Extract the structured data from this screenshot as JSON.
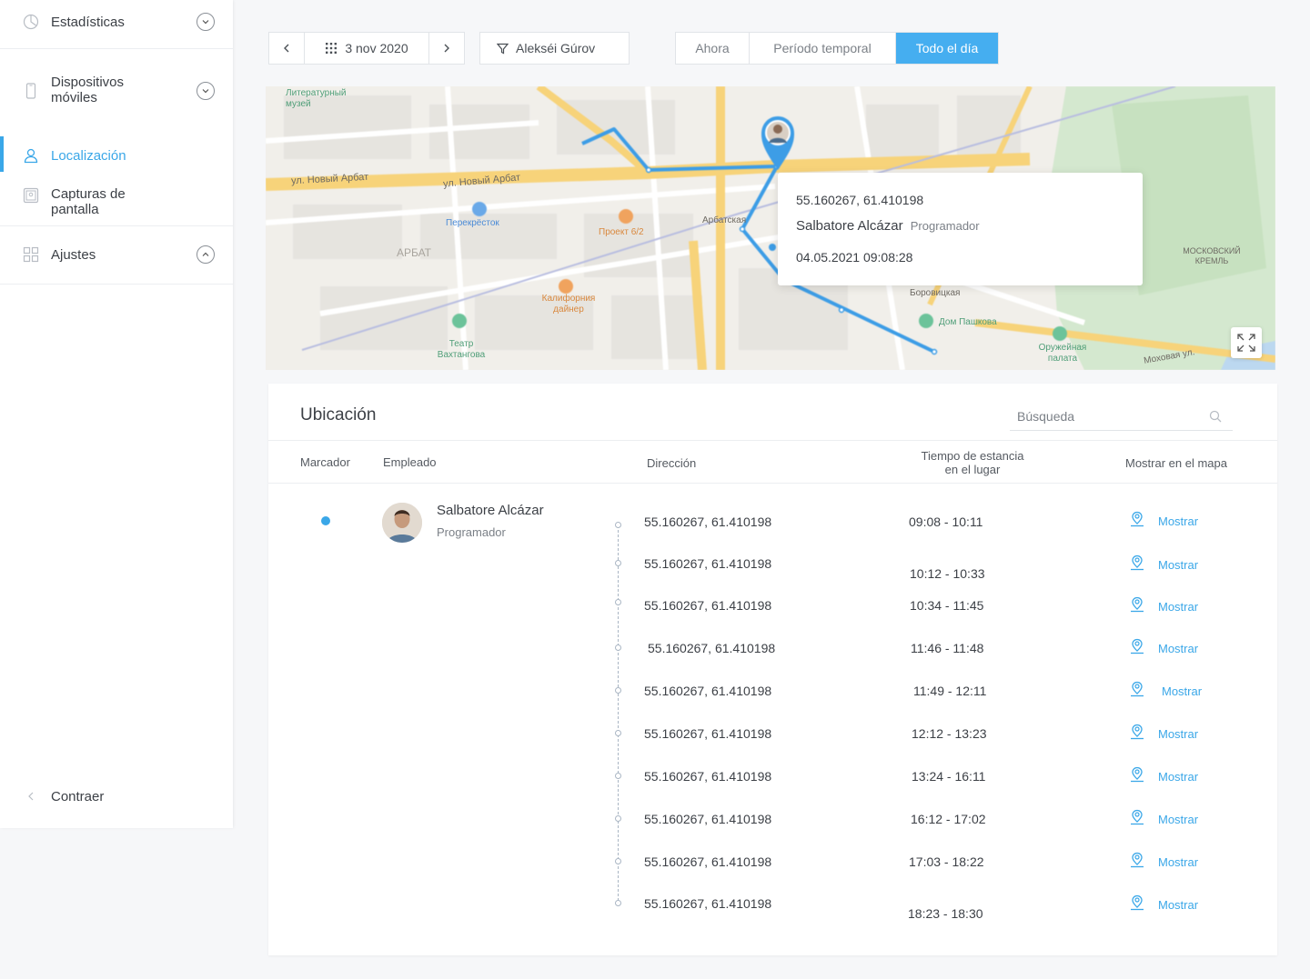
{
  "sidebar": {
    "items": [
      {
        "label": "Estadísticas"
      },
      {
        "label": "Dispositivos móviles"
      },
      {
        "label": "Localización"
      },
      {
        "label": "Capturas de pantalla"
      },
      {
        "label": "Ajustes"
      }
    ],
    "collapse_label": "Contraer"
  },
  "toolbar": {
    "date": "3 nov 2020",
    "employee_filter": "Alekséi Gúrov",
    "modes": [
      "Ahora",
      "Período temporal",
      "Todo el día"
    ],
    "selected_mode": "Todo el día"
  },
  "map": {
    "popup": {
      "coords": "55.160267, 61.410198",
      "name": "Salbatore Alcázar",
      "role": "Programador",
      "datetime": "04.05.2021 09:08:28"
    },
    "street_labels": [
      "ул. Новый Арбат",
      "ул. Новый Арбат",
      "Перекрёсток",
      "Проект 6/2",
      "Калифорния дайнер",
      "Театр Вахтангова",
      "АРБАТ",
      "Литературный музей",
      "Арбатская",
      "Боровицкая",
      "Дом Пашкова",
      "Оружейная палата",
      "МОСКОВСКИЙ КРЕМЛЬ",
      "Моховая ул."
    ]
  },
  "panel": {
    "title": "Ubicación",
    "search_placeholder": "Búsqueda",
    "columns": {
      "marker": "Marcador",
      "employee": "Empleado",
      "address": "Dirección",
      "stay_1": "Tiempo de estancia",
      "stay_2": "en el lugar",
      "show": "Mostrar en el mapa"
    },
    "employee": {
      "name": "Salbatore Alcázar",
      "role": "Programador"
    },
    "rows": [
      {
        "address": "55.160267, 61.410198",
        "time": "09:08 - 10:11",
        "action": "Mostrar"
      },
      {
        "address": "55.160267, 61.410198",
        "time": "10:12 - 10:33",
        "action": "Mostrar"
      },
      {
        "address": "55.160267, 61.410198",
        "time": "10:34 - 11:45",
        "action": "Mostrar"
      },
      {
        "address": "55.160267, 61.410198",
        "time": "11:46 - 11:48",
        "action": "Mostrar"
      },
      {
        "address": "55.160267, 61.410198",
        "time": "11:49 - 12:11",
        "action": "Mostrar"
      },
      {
        "address": "55.160267, 61.410198",
        "time": "12:12 - 13:23",
        "action": "Mostrar"
      },
      {
        "address": "55.160267, 61.410198",
        "time": "13:24 - 16:11",
        "action": "Mostrar"
      },
      {
        "address": "55.160267, 61.410198",
        "time": "16:12 - 17:02",
        "action": "Mostrar"
      },
      {
        "address": "55.160267, 61.410198",
        "time": "17:03 - 18:22",
        "action": "Mostrar"
      },
      {
        "address": "55.160267, 61.410198",
        "time": "18:23 - 18:30",
        "action": "Mostrar"
      }
    ]
  },
  "colors": {
    "accent": "#3aa7e8",
    "route": "#3d9de6",
    "road_yellow": "#f7d37a"
  }
}
